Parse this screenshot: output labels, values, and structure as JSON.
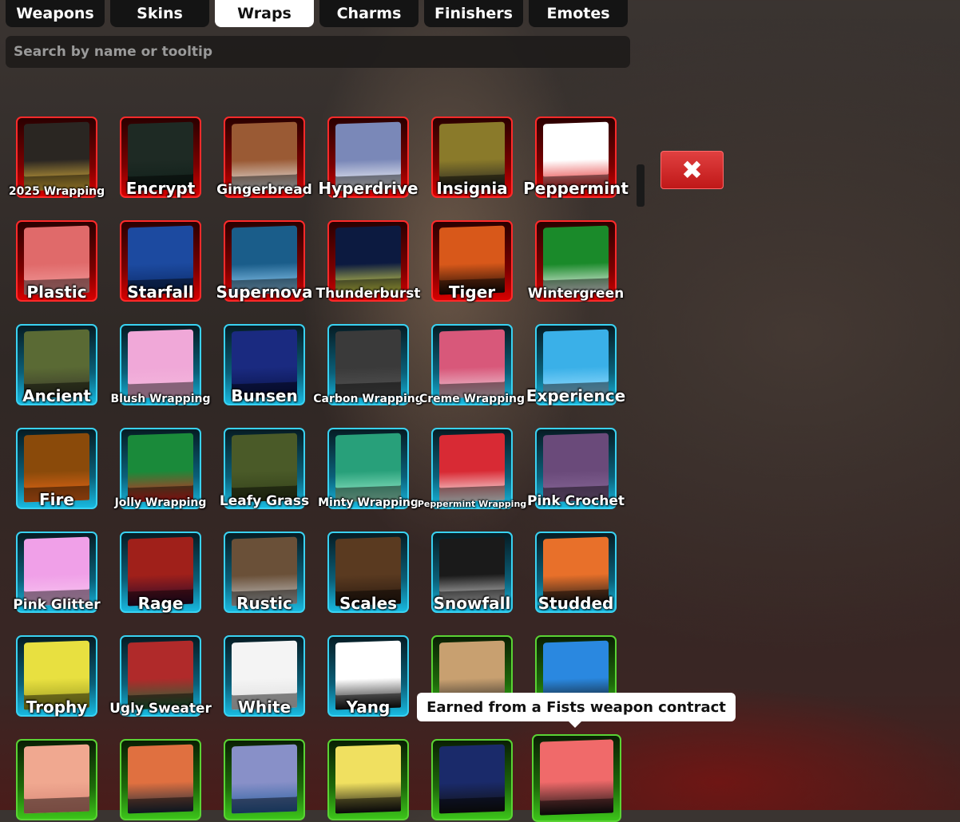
{
  "tabs": [
    {
      "label": "Weapons",
      "active": false
    },
    {
      "label": "Skins",
      "active": false
    },
    {
      "label": "Wraps",
      "active": true
    },
    {
      "label": "Charms",
      "active": false
    },
    {
      "label": "Finishers",
      "active": false
    },
    {
      "label": "Emotes",
      "active": false
    }
  ],
  "search": {
    "placeholder": "Search by name or tooltip",
    "value": ""
  },
  "close_button": {
    "icon": "close-x-icon",
    "glyph": "✖",
    "color": "#d32a2a"
  },
  "tooltip": {
    "text": "Earned from a Fists weapon contract"
  },
  "rarity_colors": {
    "red": "#ff2a2a",
    "cyan": "#39d2f2",
    "green": "#5ad334"
  },
  "wraps": [
    {
      "name": "2025 Wrapping",
      "rarity": "red",
      "swatch": "#2a2622",
      "accent": "#f0c040"
    },
    {
      "name": "Encrypt",
      "rarity": "red",
      "swatch": "#1e2a24",
      "accent": "#10201a"
    },
    {
      "name": "Gingerbread",
      "rarity": "red",
      "swatch": "#9a5a34",
      "accent": "#eee"
    },
    {
      "name": "Hyperdrive",
      "rarity": "red",
      "swatch": "#7a88b8",
      "accent": "#ffffff"
    },
    {
      "name": "Insignia",
      "rarity": "red",
      "swatch": "#8a7a2a",
      "accent": "#222"
    },
    {
      "name": "Peppermint",
      "rarity": "red",
      "swatch": "#ffffff",
      "accent": "#e01818"
    },
    {
      "name": "Plastic",
      "rarity": "red",
      "swatch": "#e06a6a",
      "accent": "#f3a0a0"
    },
    {
      "name": "Starfall",
      "rarity": "red",
      "swatch": "#1c4aa0",
      "accent": "#0c2a66"
    },
    {
      "name": "Supernova",
      "rarity": "red",
      "swatch": "#1a5d8a",
      "accent": "#9cd8ff"
    },
    {
      "name": "Thunderburst",
      "rarity": "red",
      "swatch": "#0c1a40",
      "accent": "#f0f050"
    },
    {
      "name": "Tiger",
      "rarity": "red",
      "swatch": "#d8581a",
      "accent": "#1a0a05"
    },
    {
      "name": "Wintergreen",
      "rarity": "red",
      "swatch": "#1a8a2a",
      "accent": "#ffffff"
    },
    {
      "name": "Ancient",
      "rarity": "cyan",
      "swatch": "#5a6a34",
      "accent": "#3a3a2a"
    },
    {
      "name": "Blush Wrapping",
      "rarity": "cyan",
      "swatch": "#f0a8d8",
      "accent": "#f4b8dc"
    },
    {
      "name": "Bunsen",
      "rarity": "cyan",
      "swatch": "#1a2a80",
      "accent": "#0a144a"
    },
    {
      "name": "Carbon Wrapping",
      "rarity": "cyan",
      "swatch": "#3a3a3a",
      "accent": "#555"
    },
    {
      "name": "Creme Wrapping",
      "rarity": "cyan",
      "swatch": "#d8587a",
      "accent": "#f0d0dc"
    },
    {
      "name": "Experience",
      "rarity": "cyan",
      "swatch": "#3ab0e8",
      "accent": "#9ee0ff"
    },
    {
      "name": "Fire",
      "rarity": "cyan",
      "swatch": "#8a4a0a",
      "accent": "#f06a18"
    },
    {
      "name": "Jolly Wrapping",
      "rarity": "cyan",
      "swatch": "#1a8a3a",
      "accent": "#e02020"
    },
    {
      "name": "Leafy Grass",
      "rarity": "cyan",
      "swatch": "#4a5a28",
      "accent": "#33401a"
    },
    {
      "name": "Minty Wrapping",
      "rarity": "cyan",
      "swatch": "#28a07a",
      "accent": "#a0f0d0"
    },
    {
      "name": "Peppermint Wrapping",
      "rarity": "cyan",
      "swatch": "#d82a34",
      "accent": "#ffffff"
    },
    {
      "name": "Pink Crochet",
      "rarity": "cyan",
      "swatch": "#6a4a7a",
      "accent": "#8a6a9a"
    },
    {
      "name": "Pink Glitter",
      "rarity": "cyan",
      "swatch": "#f0a0e8",
      "accent": "#f8c8f0"
    },
    {
      "name": "Rage",
      "rarity": "cyan",
      "swatch": "#a0201a",
      "accent": "#2a0a2a"
    },
    {
      "name": "Rustic",
      "rarity": "cyan",
      "swatch": "#6a5038",
      "accent": "#c8c8c8"
    },
    {
      "name": "Scales",
      "rarity": "cyan",
      "swatch": "#5a3a20",
      "accent": "#2a1a10"
    },
    {
      "name": "Snowfall",
      "rarity": "cyan",
      "swatch": "#1a1a1a",
      "accent": "#dddddd"
    },
    {
      "name": "Studded",
      "rarity": "cyan",
      "swatch": "#e8702a",
      "accent": "#1a1a1a"
    },
    {
      "name": "Trophy",
      "rarity": "cyan",
      "swatch": "#e8e040",
      "accent": "#9a9a20"
    },
    {
      "name": "Ugly Sweater",
      "rarity": "cyan",
      "swatch": "#b02a2a",
      "accent": "#1a6a3a"
    },
    {
      "name": "White",
      "rarity": "cyan",
      "swatch": "#f4f4f4",
      "accent": "#dddddd"
    },
    {
      "name": "Yang",
      "rarity": "cyan",
      "swatch": "#ffffff",
      "accent": "#111111"
    },
    {
      "name": "",
      "rarity": "green",
      "swatch": "#c8a070",
      "accent": "#222"
    },
    {
      "name": "",
      "rarity": "green",
      "swatch": "#2a88e0",
      "accent": "#111"
    },
    {
      "name": "",
      "rarity": "green",
      "swatch": "#f0a890",
      "accent": "#d88878"
    },
    {
      "name": "",
      "rarity": "green",
      "swatch": "#e07040",
      "accent": "#1a2a3a"
    },
    {
      "name": "",
      "rarity": "green",
      "swatch": "#8890c8",
      "accent": "#2a60a0"
    },
    {
      "name": "",
      "rarity": "green",
      "swatch": "#f0e060",
      "accent": "#111"
    },
    {
      "name": "",
      "rarity": "green",
      "swatch": "#1a2a6a",
      "accent": "#111"
    },
    {
      "name": "",
      "rarity": "green",
      "swatch": "#f06a6a",
      "accent": "#111"
    }
  ]
}
